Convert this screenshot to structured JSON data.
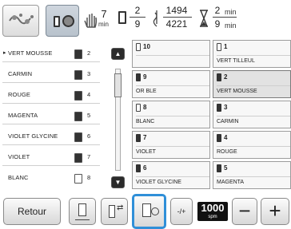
{
  "top": {
    "stitch_time": {
      "value": "7",
      "unit": "min"
    },
    "color_progress": {
      "current": "2",
      "total": "9"
    },
    "stitch_count": {
      "current": "1494",
      "total": "4221"
    },
    "remaining_time": {
      "current": "2",
      "unit_current": "min",
      "total": "9",
      "unit_total": "min"
    }
  },
  "thread_list": [
    {
      "name": "VERT MOUSSE",
      "num": "2",
      "current": true
    },
    {
      "name": "CARMIN",
      "num": "3"
    },
    {
      "name": "ROUGE",
      "num": "4"
    },
    {
      "name": "MAGENTA",
      "num": "5"
    },
    {
      "name": "VIOLET GLYCINE",
      "num": "6"
    },
    {
      "name": "VIOLET",
      "num": "7"
    },
    {
      "name": "BLANC",
      "num": "8"
    }
  ],
  "grid": {
    "left": [
      {
        "num": "10",
        "name": ""
      },
      {
        "num": "9",
        "name": "OR BLE"
      },
      {
        "num": "8",
        "name": "BLANC"
      },
      {
        "num": "7",
        "name": "VIOLET"
      },
      {
        "num": "6",
        "name": "VIOLET GLYCINE"
      }
    ],
    "right": [
      {
        "num": "1",
        "name": "VERT TILLEUL"
      },
      {
        "num": "2",
        "name": "VERT MOUSSE"
      },
      {
        "num": "3",
        "name": "CARMIN"
      },
      {
        "num": "4",
        "name": "ROUGE"
      },
      {
        "num": "5",
        "name": "MAGENTA"
      }
    ]
  },
  "bottom": {
    "back_label": "Retour",
    "speed_toggle": "-/+",
    "speed_value": "1000",
    "speed_unit": "spm",
    "minus": "−",
    "plus": "+"
  },
  "colors": {
    "accent": "#2f8fd8",
    "dark": "#2b2b2b"
  }
}
